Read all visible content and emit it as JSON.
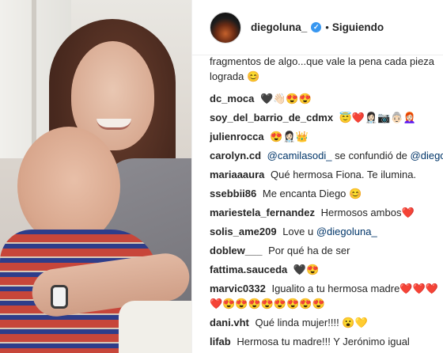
{
  "post": {
    "author": "diegoluna_",
    "verified_icon": "verified-badge-icon",
    "separator": "•",
    "follow_status": "Siguiendo"
  },
  "comments": [
    {
      "user": "",
      "text": "fragmentos de algo...que vale la pena cada pieza lograda 😊"
    },
    {
      "user": "dc_moca",
      "text": "🖤👋🏻😍😍"
    },
    {
      "user": "soy_del_barrio_de_cdmx",
      "text": "😇❤️👩🏻‍⚕️📷👵🏻👩🏻‍🦰"
    },
    {
      "user": "julienrocca",
      "text": "😍👩🏻‍⚕️👑"
    },
    {
      "user": "carolyn.cd",
      "mention1": "@camilasodi_",
      "text": " se confundió de ",
      "mention2": "@diego"
    },
    {
      "user": "mariaaaura",
      "text": "Qué hermosa Fiona. Te ilumina."
    },
    {
      "user": "ssebbii86",
      "text": "Me encanta Diego 😊"
    },
    {
      "user": "mariestela_fernandez",
      "text": "Hermosos ambos❤️"
    },
    {
      "user": "solis_ame209",
      "text": "Love u ",
      "mention": "@diegoluna_"
    },
    {
      "user": "doblew___",
      "text": "Por qué ha de ser"
    },
    {
      "user": "fattima.sauceda",
      "text": "🖤😍"
    },
    {
      "user": "marvic0332",
      "text": "Igualito a tu hermosa madre❤️❤️❤️❤️😍😍😍😍😍😍😍😍"
    },
    {
      "user": "dani.vht",
      "text": "Qué linda mujer!!!! 😮💛"
    },
    {
      "user": "lifab",
      "text": "Hermosa tu madre!!! Y Jerónimo igual"
    }
  ]
}
